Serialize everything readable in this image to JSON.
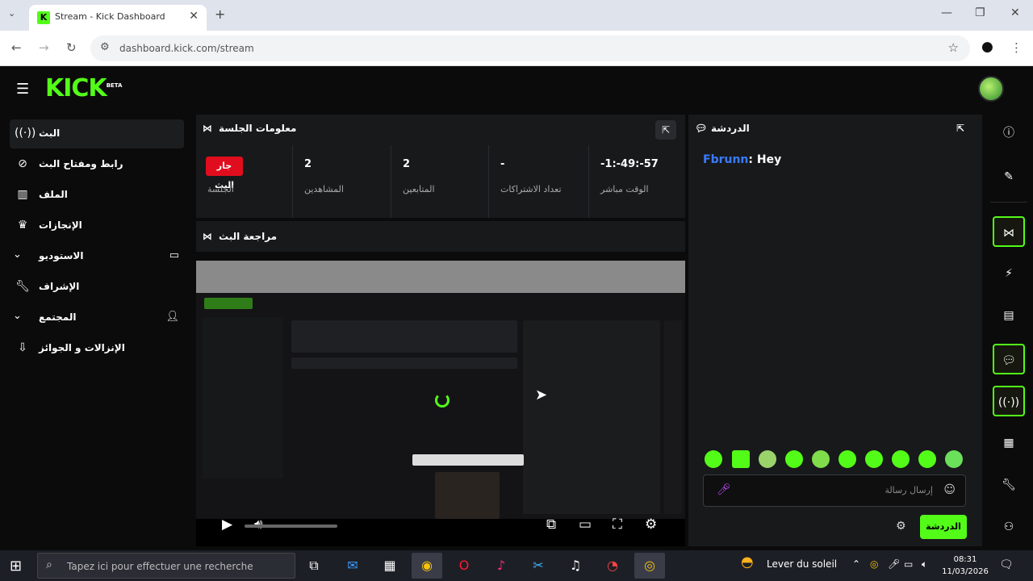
{
  "browser": {
    "tab_title": "Stream - Kick Dashboard",
    "url": "dashboard.kick.com/stream",
    "new_tab": "+",
    "close_tab": "✕",
    "minimize": "—",
    "restore": "❐",
    "close": "✕"
  },
  "topbar": {
    "logo": "KICK",
    "logo_sup": "BETA"
  },
  "sidebar": {
    "items": [
      {
        "label": "البث",
        "icon": "stream-icon"
      },
      {
        "label": "رابط ومفتاح البث",
        "icon": "link-icon"
      },
      {
        "label": "الملف",
        "icon": "chart-icon"
      },
      {
        "label": "الإنجازات",
        "icon": "trophy-icon"
      },
      {
        "label": "الاستوديو",
        "icon": "studio-icon"
      },
      {
        "label": "الإشراف",
        "icon": "wrench-icon"
      },
      {
        "label": "المجتمع",
        "icon": "community-icon"
      },
      {
        "label": "الإنزالات و الجوائز",
        "icon": "gift-icon"
      }
    ]
  },
  "session": {
    "title": "معلومات الجلسة",
    "live_badge": "جار البث",
    "stats": [
      {
        "value": "",
        "caption": "الجلسة"
      },
      {
        "value": "2",
        "caption": "المشاهدين"
      },
      {
        "value": "2",
        "caption": "المتابعين"
      },
      {
        "value": "-",
        "caption": "تعداد الاشتراكات"
      },
      {
        "value": "-1:-49:-57",
        "caption": "الوقت مباشر"
      }
    ]
  },
  "preview": {
    "title": "مراجعة البث"
  },
  "chat": {
    "title": "الدردشة",
    "message_user": "Fbrunn",
    "message_text": ": Hey",
    "input_placeholder": "إرسال رسالة",
    "send_label": "الدردشة"
  },
  "taskbar": {
    "search_placeholder": "Tapez ici pour effectuer une recherche",
    "weather": "Lever du soleil",
    "time": "08:31",
    "date": "11/03/2026"
  },
  "colors": {
    "accent": "#53fc18",
    "live": "#e00d1e",
    "chat_user": "#3a7bff"
  }
}
